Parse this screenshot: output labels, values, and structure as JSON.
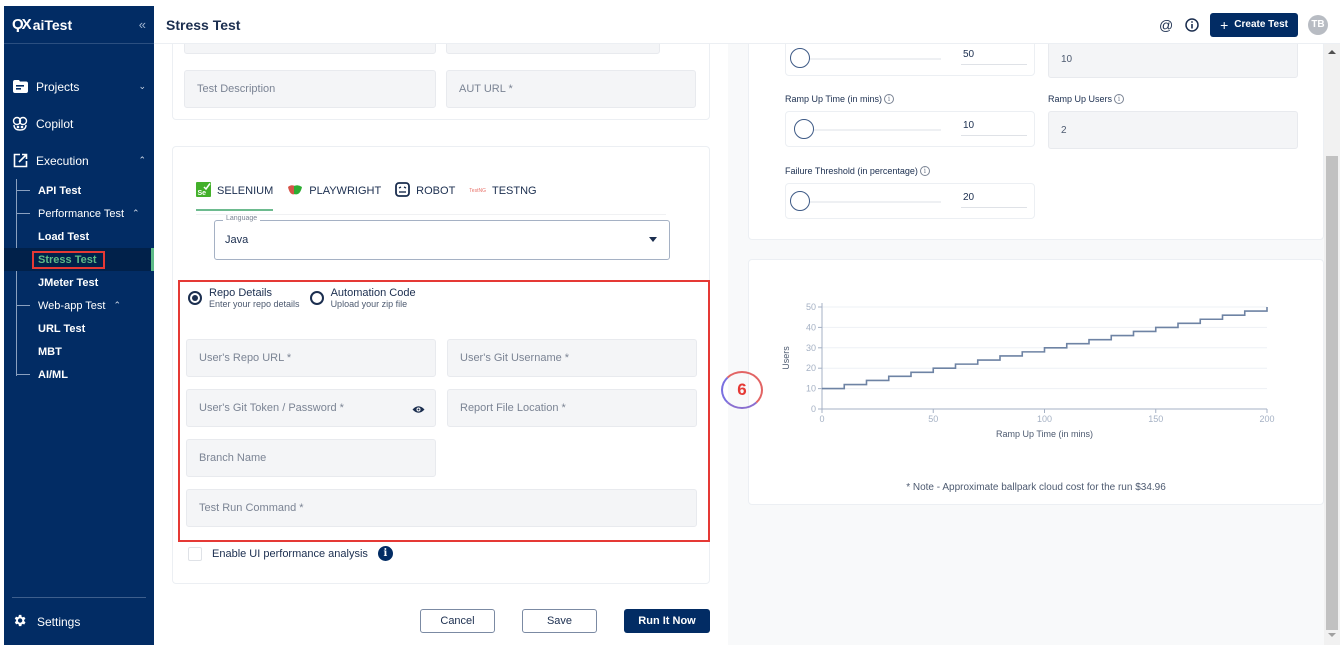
{
  "sidebar": {
    "brand": "aiTest",
    "brand_mark": "ϘX",
    "collapse_icon": "double-chevron-left-icon",
    "items": [
      {
        "label": "Projects",
        "icon": "folder-icon",
        "expanded": false
      },
      {
        "label": "Copilot",
        "icon": "copilot-icon"
      },
      {
        "label": "Execution",
        "icon": "external-link-icon",
        "expanded": true
      }
    ],
    "execution_children": {
      "api_test": "API Test",
      "performance_test": "Performance Test",
      "load_test": "Load Test",
      "stress_test": "Stress Test",
      "jmeter_test": "JMeter Test",
      "webapp_test": "Web-app Test",
      "url_test": "URL Test",
      "mbt": "MBT",
      "aiml": "AI/ML"
    },
    "settings": "Settings"
  },
  "header": {
    "title": "Stress Test",
    "create_button": "Create Test",
    "avatar_initials": "TB",
    "icons": [
      "at-sign-icon",
      "info-icon"
    ]
  },
  "form": {
    "test_description_placeholder": "Test Description",
    "aut_url_placeholder": "AUT URL *",
    "frameworks": [
      {
        "label": "SELENIUM",
        "active": true
      },
      {
        "label": "PLAYWRIGHT",
        "active": false
      },
      {
        "label": "ROBOT",
        "active": false
      },
      {
        "label": "TESTNG",
        "active": false
      }
    ],
    "language_label": "Language",
    "language_value": "Java",
    "source_options": [
      {
        "title": "Repo Details",
        "subtitle": "Enter your repo details",
        "selected": true
      },
      {
        "title": "Automation Code",
        "subtitle": "Upload your zip file",
        "selected": false
      }
    ],
    "repo_url_placeholder": "User's Repo URL *",
    "git_username_placeholder": "User's Git Username *",
    "git_token_placeholder": "User's Git Token / Password *",
    "report_location_placeholder": "Report File Location *",
    "branch_placeholder": "Branch Name",
    "run_command_placeholder": "Test Run Command *",
    "ui_perf_label": "Enable UI performance analysis",
    "ui_perf_checked": false,
    "cancel": "Cancel",
    "save": "Save",
    "run": "Run It Now"
  },
  "annotation": {
    "step_number": "6"
  },
  "config": {
    "users_slider_value": "50",
    "users_field_value": "10",
    "ramp_time_label": "Ramp Up Time (in mins)",
    "ramp_time_value": "10",
    "ramp_users_label": "Ramp Up Users",
    "ramp_users_value": "2",
    "failure_label": "Failure Threshold (in percentage)",
    "failure_value": "20"
  },
  "note": "* Note - Approximate ballpark cloud cost for the run $34.96",
  "chart_data": {
    "type": "line",
    "step": true,
    "title": "",
    "xlabel": "Ramp Up Time (in mins)",
    "ylabel": "Users",
    "xlim": [
      0,
      200
    ],
    "ylim": [
      0,
      50
    ],
    "xticks": [
      0,
      50,
      100,
      150,
      200
    ],
    "yticks": [
      0,
      10,
      20,
      30,
      40,
      50
    ],
    "grid": true,
    "x": [
      0,
      10,
      20,
      30,
      40,
      50,
      60,
      70,
      80,
      90,
      100,
      110,
      120,
      130,
      140,
      150,
      160,
      170,
      180,
      190,
      200
    ],
    "series": [
      {
        "name": "Users",
        "color": "#6e83a4",
        "values": [
          10,
          12,
          14,
          16,
          18,
          20,
          22,
          24,
          26,
          28,
          30,
          32,
          34,
          36,
          38,
          40,
          42,
          44,
          46,
          48,
          50
        ]
      }
    ]
  }
}
